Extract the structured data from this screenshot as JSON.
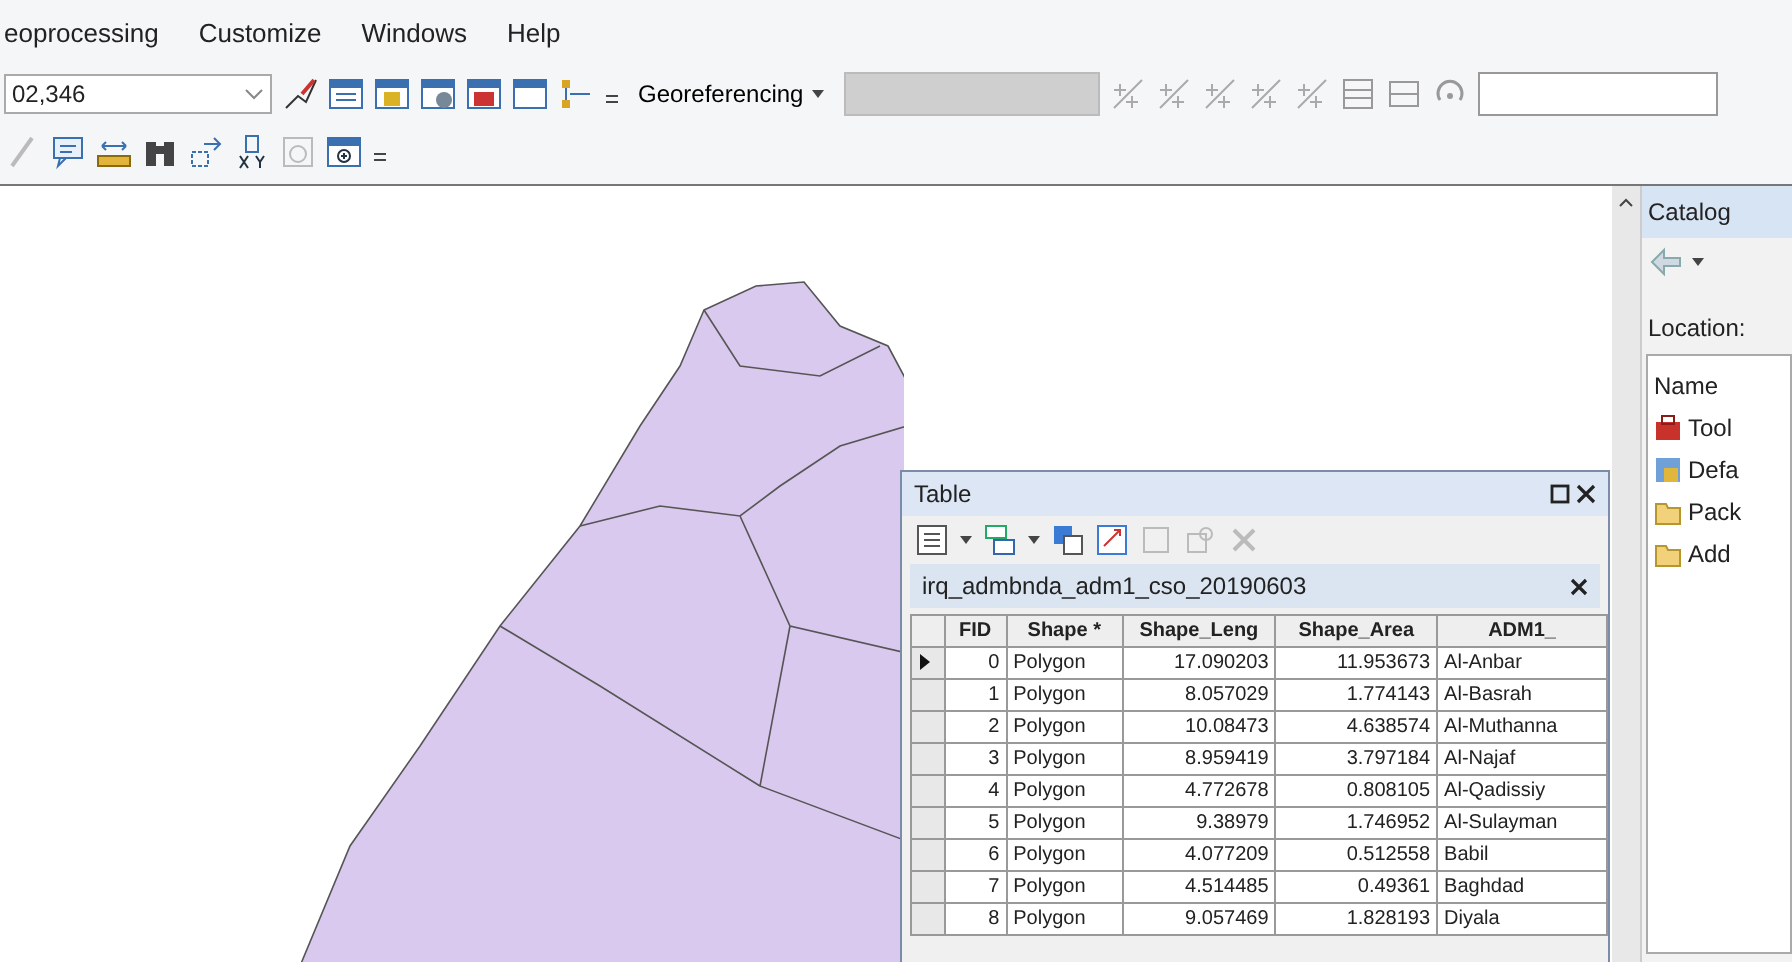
{
  "menu": [
    "eoprocessing",
    "Customize",
    "Windows",
    "Help"
  ],
  "toolbar": {
    "scale_value": "02,346",
    "georeferencing": "Georeferencing"
  },
  "table_window": {
    "title": "Table",
    "tab": "irq_admbnda_adm1_cso_20190603",
    "columns": [
      "FID",
      "Shape *",
      "Shape_Leng",
      "Shape_Area",
      "ADM1_"
    ],
    "rows": [
      {
        "selected": true,
        "cells": [
          "0",
          "Polygon",
          "17.090203",
          "11.953673",
          "Al-Anbar"
        ]
      },
      {
        "selected": false,
        "cells": [
          "1",
          "Polygon",
          "8.057029",
          "1.774143",
          "Al-Basrah"
        ]
      },
      {
        "selected": false,
        "cells": [
          "2",
          "Polygon",
          "10.08473",
          "4.638574",
          "Al-Muthanna"
        ]
      },
      {
        "selected": false,
        "cells": [
          "3",
          "Polygon",
          "8.959419",
          "3.797184",
          "Al-Najaf"
        ]
      },
      {
        "selected": false,
        "cells": [
          "4",
          "Polygon",
          "4.772678",
          "0.808105",
          "Al-Qadissiy"
        ]
      },
      {
        "selected": false,
        "cells": [
          "5",
          "Polygon",
          "9.38979",
          "1.746952",
          "Al-Sulayman"
        ]
      },
      {
        "selected": false,
        "cells": [
          "6",
          "Polygon",
          "4.077209",
          "0.512558",
          "Babil"
        ]
      },
      {
        "selected": false,
        "cells": [
          "7",
          "Polygon",
          "4.514485",
          "0.49361",
          "Baghdad"
        ]
      },
      {
        "selected": false,
        "cells": [
          "8",
          "Polygon",
          "9.057469",
          "1.828193",
          "Diyala"
        ]
      }
    ]
  },
  "catalog": {
    "title": "Catalog",
    "location_label": "Location:",
    "column": "Name",
    "items": [
      {
        "kind": "toolbox",
        "label": "Tool"
      },
      {
        "kind": "database",
        "label": "Defa"
      },
      {
        "kind": "folder",
        "label": "Pack"
      },
      {
        "kind": "folder",
        "label": "Add"
      }
    ]
  }
}
